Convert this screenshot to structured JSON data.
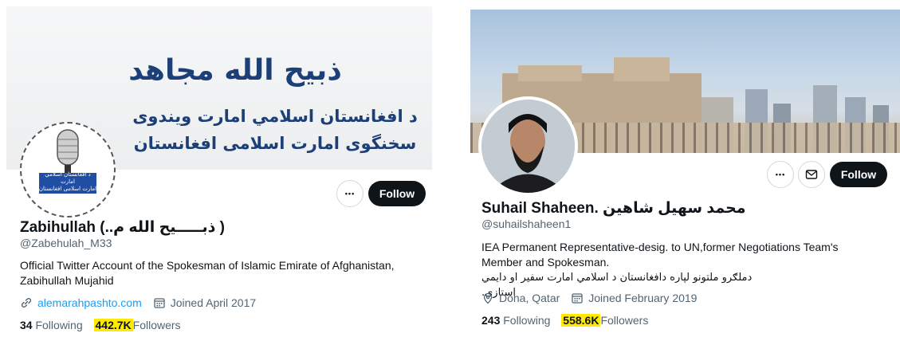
{
  "left_profile": {
    "banner": {
      "arabic_line1": "ذبیح الله مجاهد",
      "arabic_line2": "د افغانستان اسلامي امارت ویندوی",
      "arabic_line3": "سخنگوی امارت اسلامی افغانستان"
    },
    "avatar": {
      "caption1": "د افغانستان اسلامي امارت",
      "caption2": "امارت اسلامی افغانستان"
    },
    "more_label": "•••",
    "follow_label": "Follow",
    "display_name": "Zabihullah (..ذبـــــیح الله م )",
    "handle": "@Zabehulah_M33",
    "bio": "Official Twitter Account of the Spokesman of Islamic Emirate of Afghanistan, Zabihullah Mujahid",
    "website": "alemarahpashto.com",
    "joined": "Joined April 2017",
    "following_count": "34",
    "following_label": "Following",
    "followers_count": "442.7K",
    "followers_label": "Followers"
  },
  "right_profile": {
    "more_label": "•••",
    "follow_label": "Follow",
    "display_name": "Suhail Shaheen. محمد سهیل شاهین",
    "handle": "@suhailshaheen1",
    "bio_line1": "IEA Permanent Representative-desig. to UN,former Negotiations Team's Member and Spokesman.",
    "bio_line2": "دملګرو ملتونو لپاره دافغانستان د اسلامي امارت سفير او دايمي استازی.",
    "location": "Doha, Qatar",
    "joined": "Joined February 2019",
    "following_count": "243",
    "following_label": "Following",
    "followers_count": "558.6K",
    "followers_label": "Followers"
  },
  "colors": {
    "accent_link": "#1d9bf0",
    "highlight": "#ffeb00",
    "button_dark": "#0f1419",
    "secondary_text": "#536471"
  }
}
